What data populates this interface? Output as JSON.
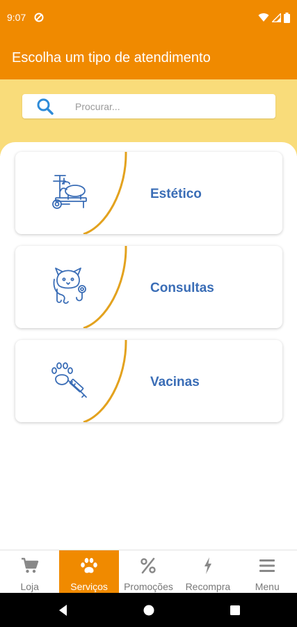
{
  "status_bar": {
    "time": "9:07"
  },
  "header": {
    "title": "Escolha um tipo de atendimento"
  },
  "search": {
    "placeholder": "Procurar..."
  },
  "services": [
    {
      "label": "Estético",
      "icon": "grooming-table-icon"
    },
    {
      "label": "Consultas",
      "icon": "cat-stethoscope-icon"
    },
    {
      "label": "Vacinas",
      "icon": "paw-syringe-icon"
    }
  ],
  "bottom_nav": {
    "active": "Serviços",
    "items": [
      {
        "label": "Loja",
        "icon": "cart-icon"
      },
      {
        "label": "Serviços",
        "icon": "paw-icon"
      },
      {
        "label": "Promoções",
        "icon": "percent-icon"
      },
      {
        "label": "Recompra",
        "icon": "lightning-icon"
      },
      {
        "label": "Menu",
        "icon": "hamburger-icon"
      }
    ]
  },
  "colors": {
    "primary": "#F08A00",
    "search_band": "#F9DC7A",
    "accent_text": "#3A6DB6",
    "arc": "#E3A21E"
  }
}
